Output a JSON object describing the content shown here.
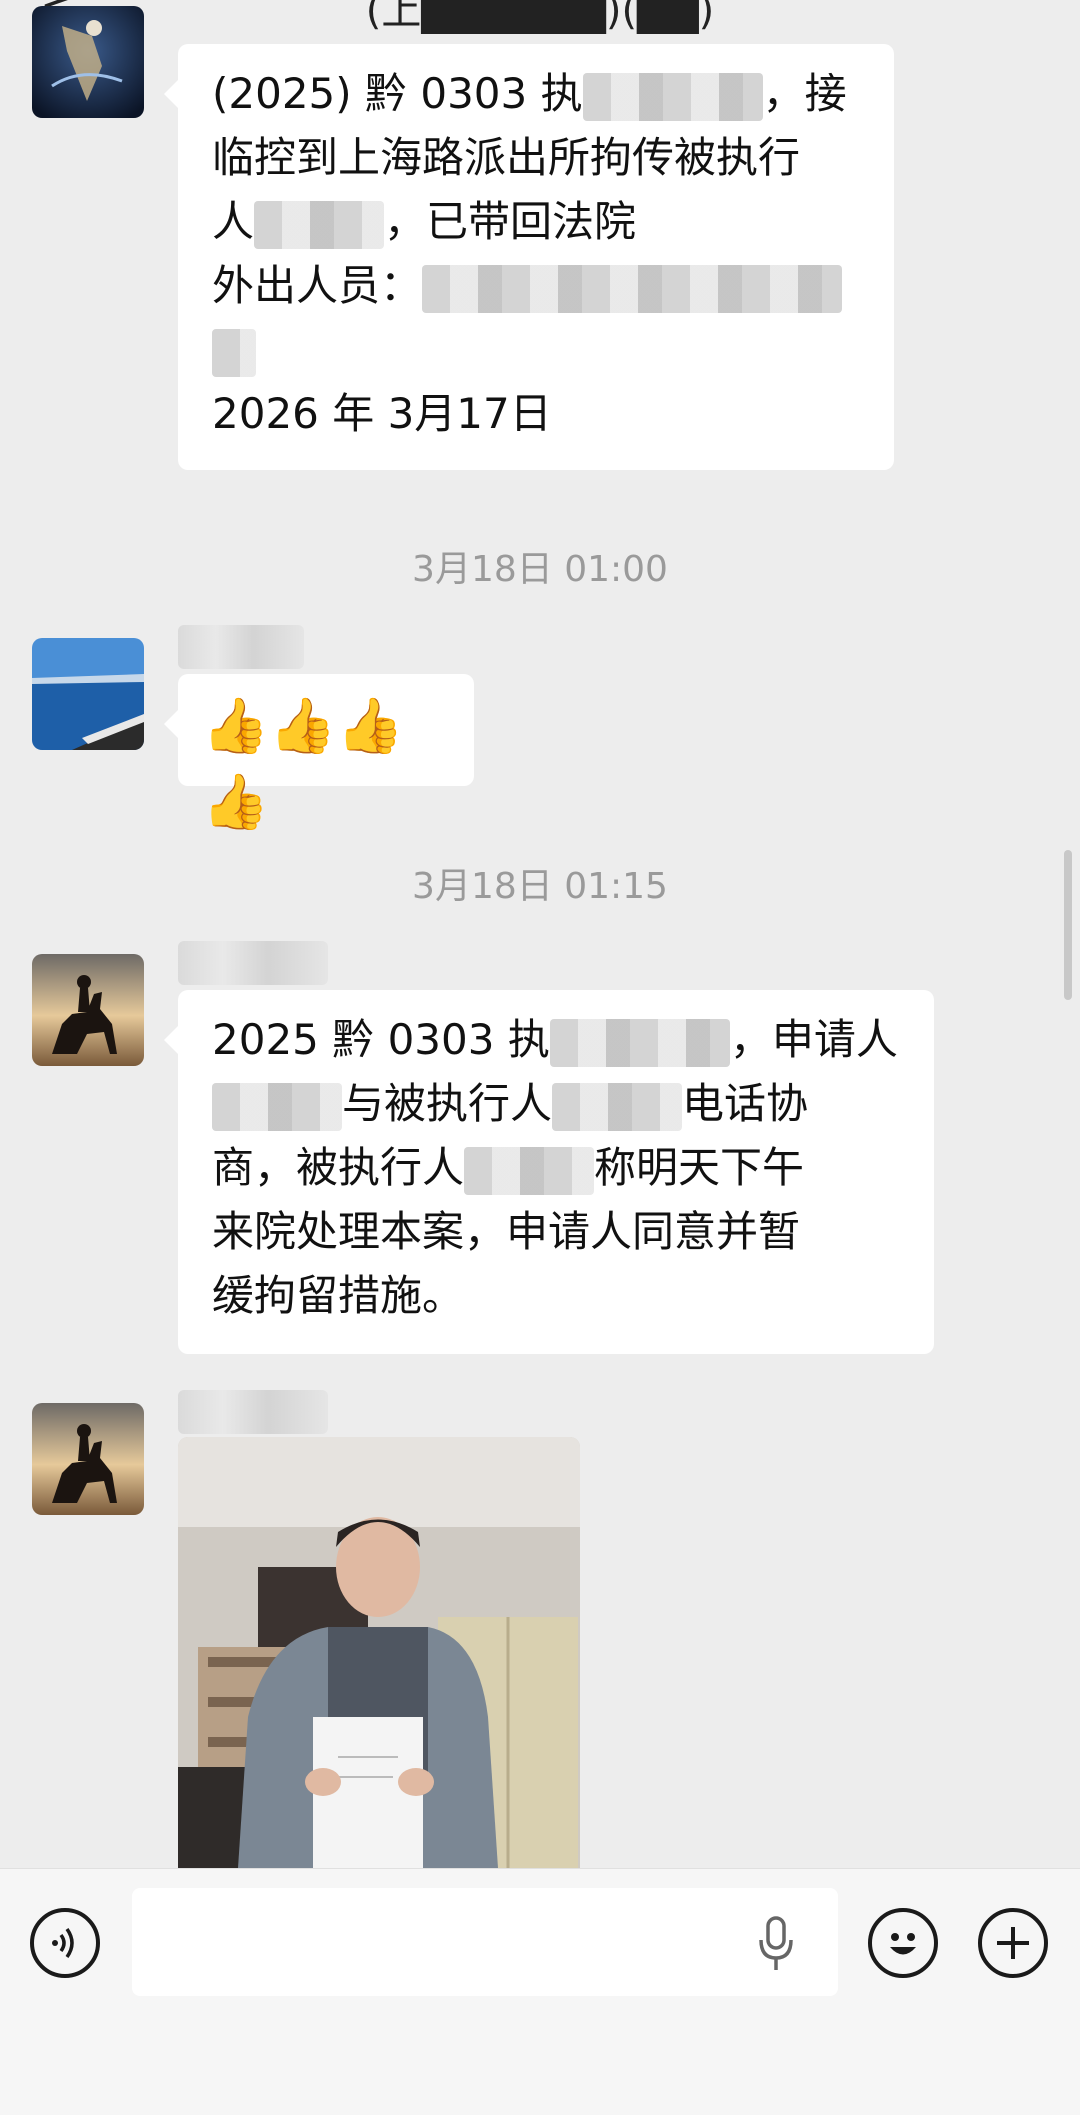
{
  "header": {
    "back_glyph": "<",
    "title": "(上▇▇▇▇▇▇)(▇▇)"
  },
  "messages": [
    {
      "type": "text",
      "lines": [
        [
          "(2025) 黔 0303 执",
          "",
          "，接"
        ],
        [
          "临控到上海路派出所拘传被执行"
        ],
        [
          "人",
          "",
          "，已带回法院"
        ],
        [
          "外出人员：",
          ""
        ],
        [
          ""
        ],
        [
          "2026 年 3月17日"
        ]
      ]
    },
    {
      "type": "timestamp",
      "text": "3月18日 01:00"
    },
    {
      "type": "emoji",
      "content": "👍👍👍👍"
    },
    {
      "type": "timestamp",
      "text": "3月18日 01:15"
    },
    {
      "type": "text",
      "lines": [
        [
          "2025 黔 0303 执",
          "",
          "，申请人"
        ],
        [
          "",
          "与被执行人",
          "",
          "电话协"
        ],
        [
          "商，被执行人",
          "",
          "称明天下午"
        ],
        [
          "来院处理本案，申请人同意并暂"
        ],
        [
          "缓拘留措施。"
        ]
      ]
    },
    {
      "type": "image",
      "paper_caption": ""
    }
  ],
  "input_bar": {
    "voice_icon": "voice-toggle-icon",
    "mic_icon": "microphone-icon",
    "emoji_icon": "emoji-smile-icon",
    "plus_icon": "plus-icon"
  },
  "colors": {
    "background": "#ededed",
    "bubble": "#ffffff",
    "timestamp": "#9a9a9a"
  }
}
